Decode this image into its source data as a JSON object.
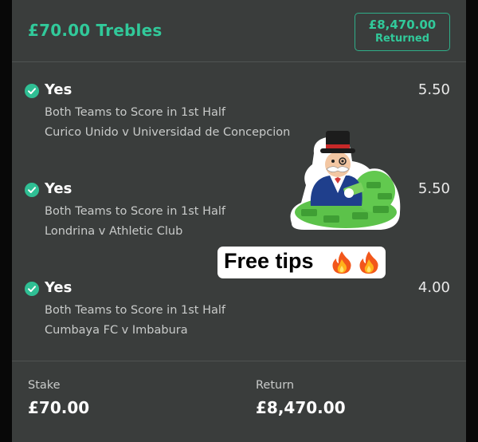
{
  "bet": {
    "title": "£70.00 Trebles",
    "returned_amount": "£8,470.00",
    "returned_label": "Returned"
  },
  "selections": [
    {
      "name": "Yes",
      "odds": "5.50",
      "market": "Both Teams to Score in 1st Half",
      "event": "Curico Unido v Universidad de Concepcion",
      "status_icon": "check-circle-icon"
    },
    {
      "name": "Yes",
      "odds": "5.50",
      "market": "Both Teams to Score in 1st Half",
      "event": "Londrina v Athletic Club",
      "status_icon": "check-circle-icon"
    },
    {
      "name": "Yes",
      "odds": "4.00",
      "market": "Both Teams to Score in 1st Half",
      "event": "Cumbaya FC v Imbabura",
      "status_icon": "check-circle-icon"
    }
  ],
  "footer": {
    "stake_label": "Stake",
    "stake_value": "£70.00",
    "return_label": "Return",
    "return_value": "£8,470.00"
  },
  "overlay": {
    "free_tips_text": "Free tips",
    "free_tips_icons": [
      "fire-icon",
      "fire-icon"
    ],
    "sticker_icon": "monopoly-man-money-sticker"
  },
  "colors": {
    "card_background": "#3a3d3c",
    "accent_green": "#31c99a",
    "divider": "#4f5352",
    "secondary_text": "#c9cbca"
  }
}
